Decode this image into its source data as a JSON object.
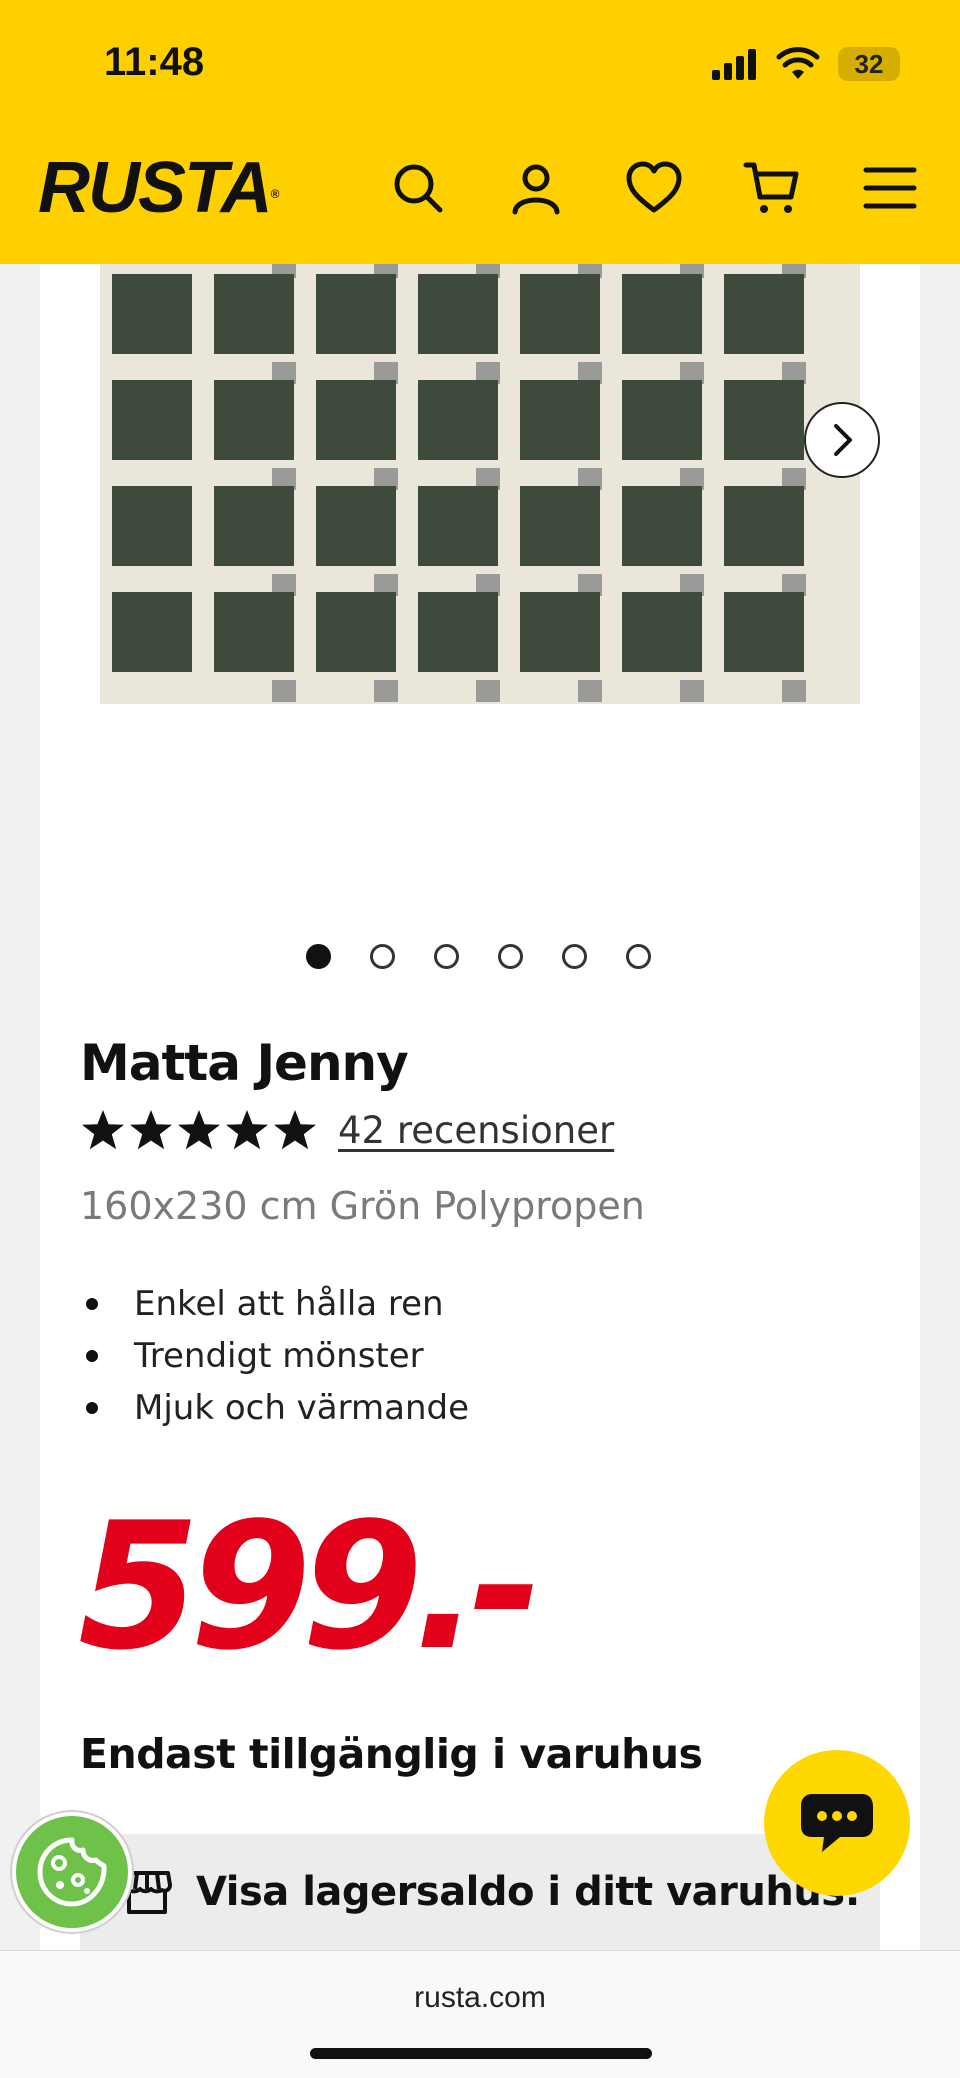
{
  "status_bar": {
    "time": "11:48",
    "battery": "32"
  },
  "header": {
    "logo": "RUSTA",
    "nav_icons": [
      "search-icon",
      "account-icon",
      "heart-icon",
      "cart-icon",
      "menu-icon"
    ],
    "background_color": "#ffd000"
  },
  "gallery": {
    "total_images": 6,
    "active_index": 0
  },
  "product": {
    "title": "Matta Jenny",
    "rating": 5,
    "review_count_label": "42 recensioner",
    "subtitle": "160x230 cm Grön Polypropen",
    "features": [
      "Enkel att hålla ren",
      "Trendigt mönster",
      "Mjuk och värmande"
    ],
    "price": "599.-",
    "price_color": "#e2001a",
    "availability": "Endast tillgänglig i varuhus",
    "stock_button": "Visa lagersaldo i ditt varuhus:"
  },
  "browser": {
    "url": "rusta.com"
  }
}
